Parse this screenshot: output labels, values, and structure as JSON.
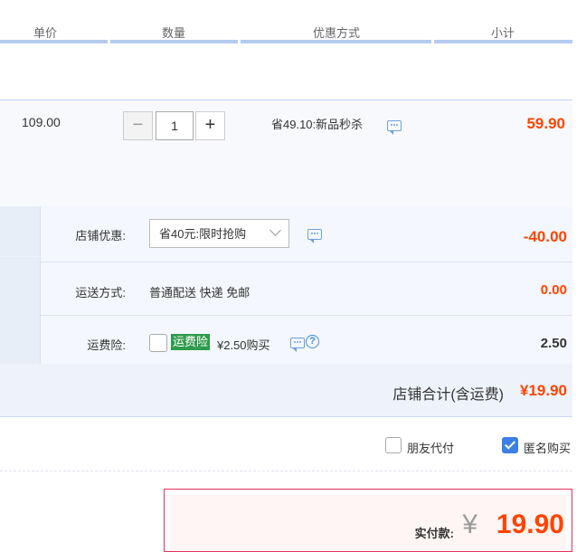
{
  "header": {
    "col_price": "单价",
    "col_qty": "数量",
    "col_discount": "优惠方式",
    "col_subtotal": "小计"
  },
  "item": {
    "unit_price": "109.00",
    "qty_minus": "−",
    "qty_value": "1",
    "qty_plus": "+",
    "promotion": "省49.10:新品秒杀",
    "subtotal": "59.90"
  },
  "shop": {
    "discount_label": "店铺优惠:",
    "discount_selected": "省40元:限时抢购",
    "discount_value": "-40.00",
    "shipping_label": "运送方式:",
    "shipping_method": "普通配送 快递 免邮",
    "shipping_value": "0.00",
    "insurance_label": "运费险:",
    "insurance_badge": "运费险",
    "insurance_text": "¥2.50购买",
    "insurance_value": "2.50",
    "total_label": "店铺合计(含运费)",
    "total_value": "¥19.90"
  },
  "options": {
    "friend_pay_label": "朋友代付",
    "friend_pay_checked": false,
    "anonymous_label": "匿名购买",
    "anonymous_checked": true
  },
  "payment": {
    "label": "实付款:",
    "currency": "¥",
    "amount": "19.90"
  },
  "colors": {
    "price_red": "#ff4400",
    "accent_blue": "#3c7fe6",
    "badge_green": "#2e9b4d"
  }
}
